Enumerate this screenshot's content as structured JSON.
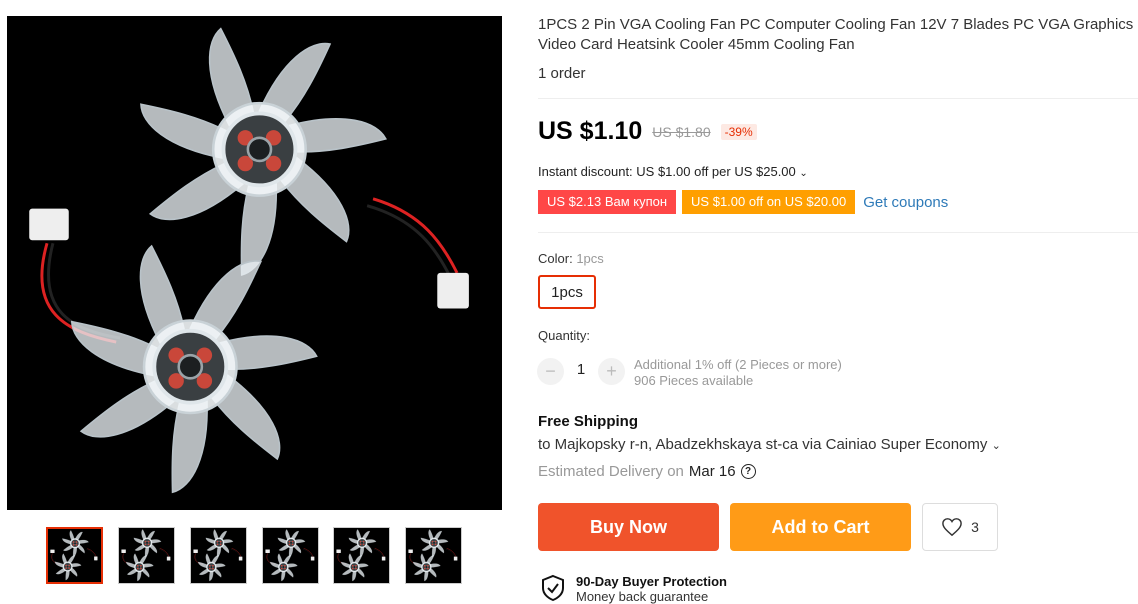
{
  "product": {
    "title_line1": "1PCS 2 Pin VGA Cooling Fan PC Computer Cooling Fan 12V 7 Blades PC VGA Graphics",
    "title_line2": "Video Card Heatsink Cooler 45mm Cooling Fan",
    "orders": "1 order"
  },
  "price": {
    "current": "US $1.10",
    "original": "US $1.80",
    "discount": "-39%"
  },
  "instant_discount": "Instant discount: US $1.00 off per US $25.00",
  "coupons": {
    "coupon1": "US $2.13 Вам купон",
    "coupon2": "US $1.00 off on US $20.00",
    "get_coupons": "Get coupons"
  },
  "color": {
    "label": "Color:",
    "selected": "1pcs",
    "options": [
      "1pcs"
    ]
  },
  "quantity": {
    "label": "Quantity:",
    "value": "1",
    "minus": "−",
    "plus": "+",
    "extra_offer": "Additional 1% off (2 Pieces or more)",
    "available": "906 Pieces available"
  },
  "shipping": {
    "title": "Free Shipping",
    "destination": "to Majkopsky r-n, Abadzekhskaya st-ca via Cainiao Super Economy",
    "estimate_label": "Estimated Delivery on",
    "estimate_date": "Mar 16",
    "help": "?"
  },
  "actions": {
    "buy_now": "Buy Now",
    "add_to_cart": "Add to Cart",
    "wish_count": "3"
  },
  "protection": {
    "title": "90-Day Buyer Protection",
    "subtitle": "Money back guarantee"
  },
  "icons": {
    "chevron": "chevron-down-icon",
    "heart": "heart-icon",
    "shield": "shield-check-icon"
  },
  "colors": {
    "accent": "#e62e04",
    "buy_now": "#f0532b",
    "add_to_cart": "#ff9b17",
    "coupon_red": "#ff4747",
    "coupon_orange": "#ff9f00",
    "link": "#2e7ab8"
  }
}
